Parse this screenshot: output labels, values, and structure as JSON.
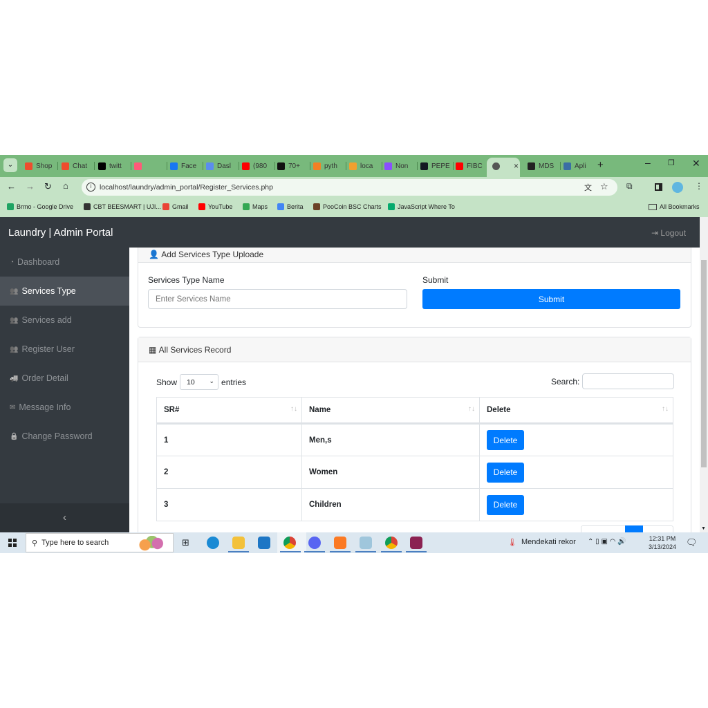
{
  "browser": {
    "tabs": [
      {
        "label": "Shop",
        "color": "#ee4d2d"
      },
      {
        "label": "Chat",
        "color": "#ee4d2d"
      },
      {
        "label": "twitt",
        "color": "#000000"
      },
      {
        "label": "",
        "color": "#ff5a79"
      },
      {
        "label": "Face",
        "color": "#1877f2"
      },
      {
        "label": "Dasl",
        "color": "#5b8def"
      },
      {
        "label": "(980",
        "color": "#ff0000"
      },
      {
        "label": "70+",
        "color": "#111111"
      },
      {
        "label": "pyth",
        "color": "#f48024"
      },
      {
        "label": "loca",
        "color": "#f0a030"
      },
      {
        "label": "Non",
        "color": "#8a4fff"
      },
      {
        "label": "PEPE",
        "color": "#131722"
      },
      {
        "label": "FIBC",
        "color": "#ff0000"
      },
      {
        "label": "",
        "color": "#555555",
        "active": true
      },
      {
        "label": "MDS",
        "color": "#222222"
      },
      {
        "label": "Apli",
        "color": "#3a6ea5"
      }
    ],
    "close_tab": "×",
    "new_tab": "+",
    "url": "localhost/laundry/admin_portal/Register_Services.php",
    "bookmarks": [
      {
        "label": "Brmo - Google Drive",
        "color": "#1fa463"
      },
      {
        "label": "CBT BEESMART | UJI...",
        "color": "#333333"
      },
      {
        "label": "Gmail",
        "color": "#ea4335"
      },
      {
        "label": "YouTube",
        "color": "#ff0000"
      },
      {
        "label": "Maps",
        "color": "#34a853"
      },
      {
        "label": "Berita",
        "color": "#4285f4"
      },
      {
        "label": "PooCoin BSC Charts",
        "color": "#6b4226"
      },
      {
        "label": "JavaScript Where To",
        "color": "#04aa6d"
      }
    ],
    "all_bookmarks": "All Bookmarks"
  },
  "app": {
    "brand": "Laundry | Admin Portal",
    "logout": "Logout",
    "sidebar": [
      {
        "label": "Dashboard",
        "icon": "dashboard-icon"
      },
      {
        "label": "Services Type",
        "icon": "users-icon",
        "active": true
      },
      {
        "label": "Services add",
        "icon": "users-icon"
      },
      {
        "label": "Register User",
        "icon": "users-icon"
      },
      {
        "label": "Order Detail",
        "icon": "truck-icon"
      },
      {
        "label": "Message Info",
        "icon": "envelope-icon"
      },
      {
        "label": "Change Password",
        "icon": "lock-icon"
      }
    ],
    "collapse": "‹",
    "form_card": {
      "title": "Add Services Type Uploade",
      "name_label": "Services Type Name",
      "name_placeholder": "Enter Services Name",
      "submit_label": "Submit",
      "submit_button": "Submit"
    },
    "records_card": {
      "title": "All Services Record",
      "show": "Show",
      "entries_value": "10",
      "entries": "entries",
      "search_label": "Search:",
      "columns": [
        "SR#",
        "Name",
        "Delete"
      ],
      "rows": [
        {
          "sr": "1",
          "name": "Men,s",
          "action": "Delete"
        },
        {
          "sr": "2",
          "name": "Women",
          "action": "Delete"
        },
        {
          "sr": "3",
          "name": "Children",
          "action": "Delete"
        }
      ]
    }
  },
  "taskbar": {
    "search_placeholder": "Type here to search",
    "weather": "Mendekati rekor",
    "time": "12:31 PM",
    "date": "3/13/2024"
  },
  "colors": {
    "primary": "#007bff",
    "dark": "#343a40",
    "chrome": "#78b97c"
  }
}
